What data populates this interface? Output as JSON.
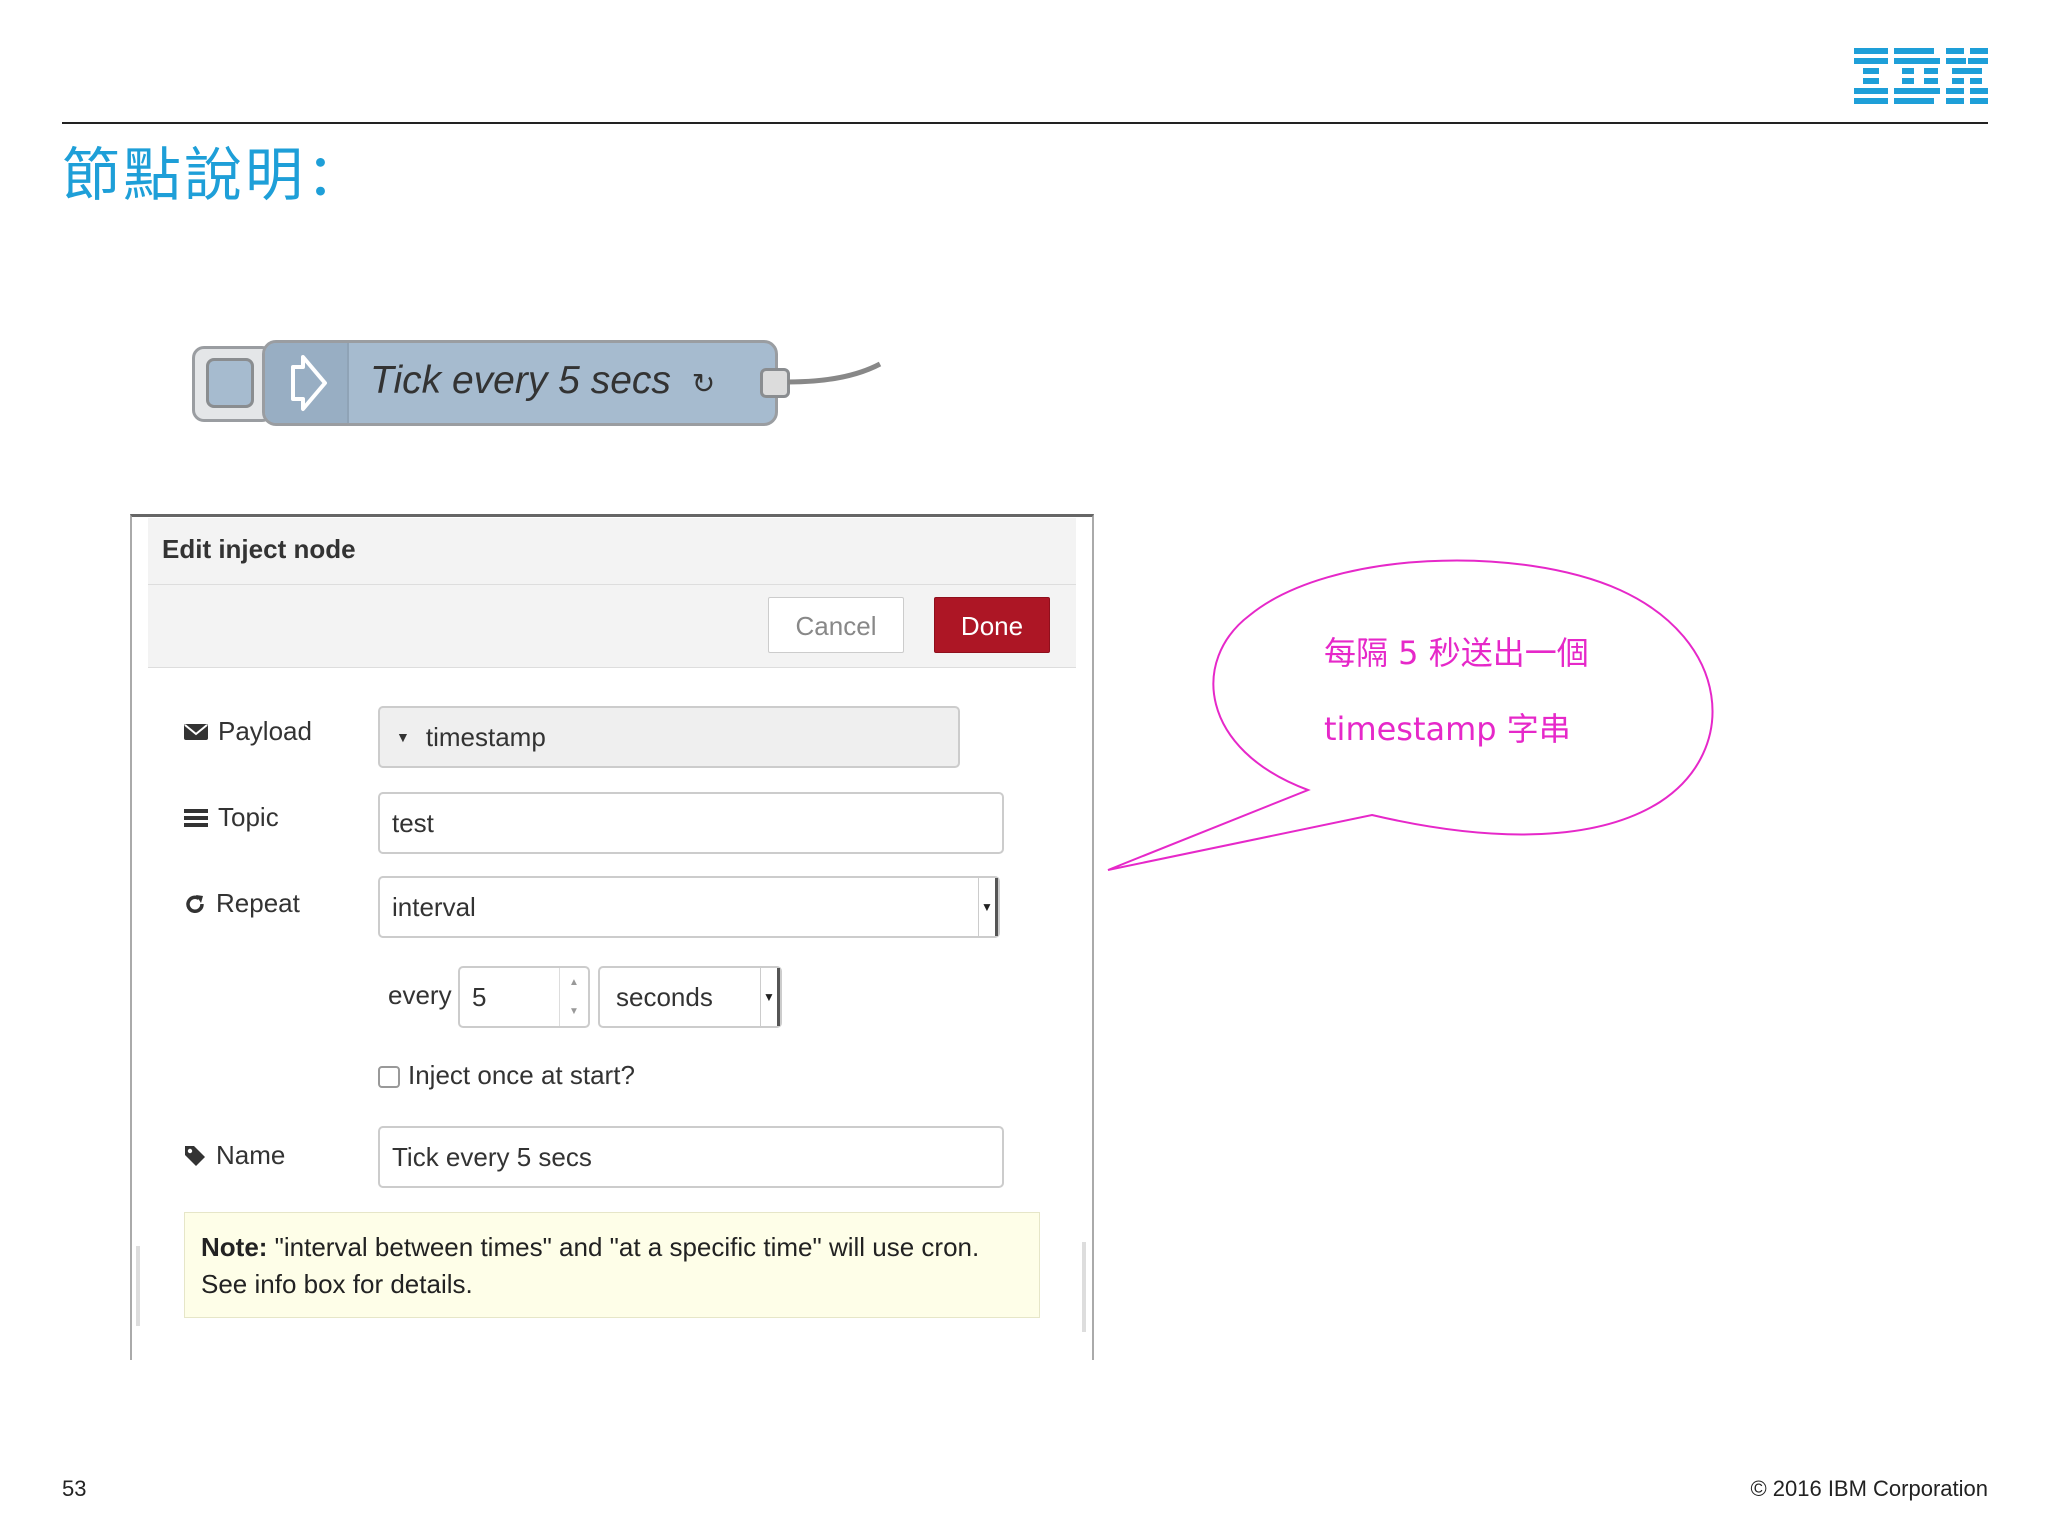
{
  "slide": {
    "title": "節點說明：",
    "logo_text": "IBM",
    "page_number": "53",
    "copyright": "© 2016 IBM Corporation"
  },
  "node": {
    "label": "Tick every 5 secs",
    "repeat_symbol": "↻",
    "icon": "arrow-right-icon",
    "color": "#a6bbcf"
  },
  "dialog": {
    "title": "Edit inject node",
    "cancel_label": "Cancel",
    "done_label": "Done",
    "payload": {
      "label": "Payload",
      "value": "timestamp",
      "icon": "envelope-icon"
    },
    "topic": {
      "label": "Topic",
      "value": "test",
      "icon": "list-icon"
    },
    "repeat": {
      "label": "Repeat",
      "value": "interval",
      "icon": "refresh-icon"
    },
    "interval": {
      "every_label": "every",
      "value": "5",
      "unit": "seconds"
    },
    "inject_once": {
      "label": "Inject once at start?",
      "checked": false
    },
    "name": {
      "label": "Name",
      "value": "Tick every 5 secs",
      "icon": "tag-icon"
    },
    "note": {
      "bold": "Note:",
      "text": " \"interval between times\" and \"at a specific time\" will use cron. See info box for details."
    }
  },
  "callout": {
    "line1": "每隔  5  秒送出一個",
    "line2": "timestamp  字串",
    "color": "#e628c9"
  },
  "colors": {
    "title_blue": "#1e9fd8",
    "done_red": "#ad1625",
    "ibm_blue": "#1f70c1"
  }
}
